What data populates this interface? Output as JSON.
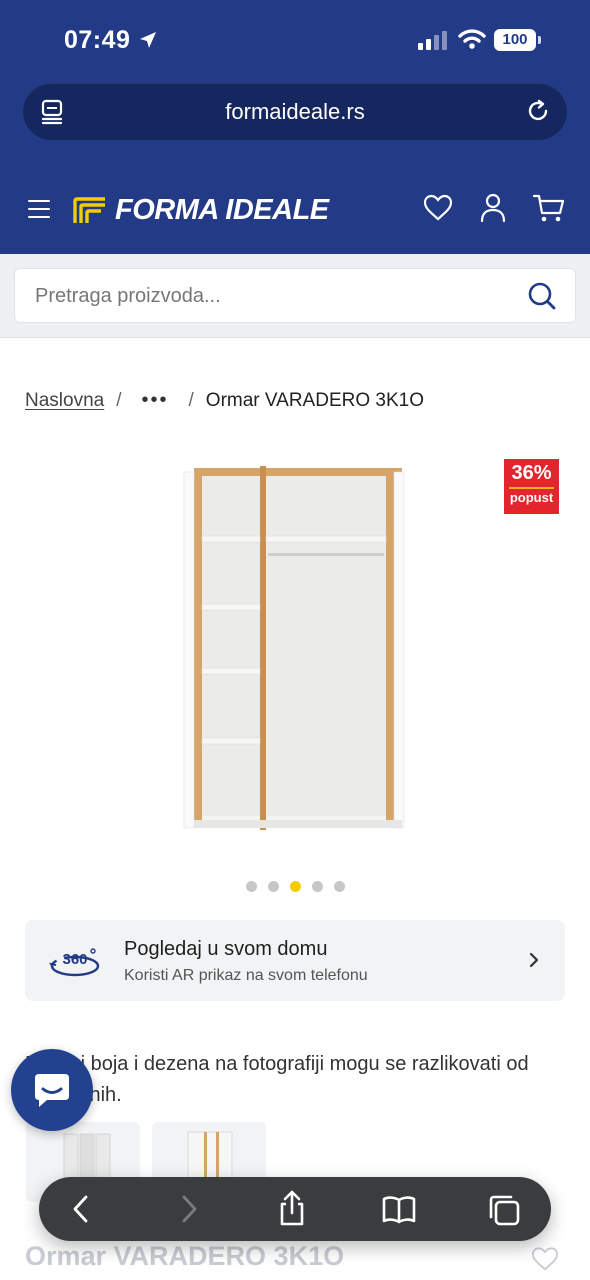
{
  "status_bar": {
    "time": "07:49",
    "battery": "100"
  },
  "browser": {
    "url": "formaideale.rs"
  },
  "brand": {
    "name": "FORMA IDEALE",
    "primary_color": "#233a86",
    "accent_color": "#f3cd00"
  },
  "search": {
    "placeholder": "Pretraga proizvoda..."
  },
  "breadcrumb": {
    "home": "Naslovna",
    "separator": "/",
    "ellipsis": "•••",
    "current": "Ormar VARADERO 3K1O"
  },
  "badge": {
    "percent": "36%",
    "label": "popust"
  },
  "gallery": {
    "total_slides": 5,
    "active_index": 3
  },
  "ar_card": {
    "title": "Pogledaj u svom domu",
    "subtitle": "Koristi AR prikaz na svom telefonu",
    "icon_text": "360°"
  },
  "disclaimer": "Prikazi boja i dezena na fotografiji mogu se razlikovati od originalnih.",
  "product": {
    "title": "Ormar VARADERO 3K1O"
  },
  "icons": {
    "nav": [
      "menu-icon",
      "heart-icon",
      "user-icon",
      "cart-icon"
    ],
    "toolbar": [
      "back-icon",
      "forward-icon",
      "share-icon",
      "bookmarks-icon",
      "tabs-icon"
    ]
  }
}
